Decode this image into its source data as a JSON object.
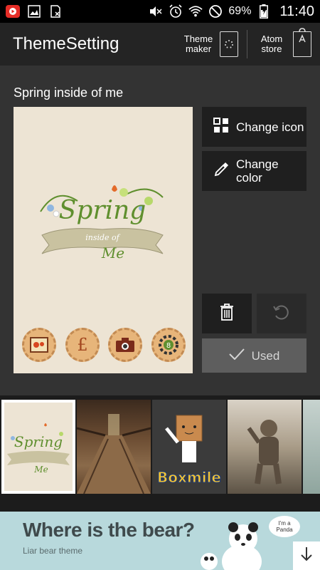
{
  "status_bar": {
    "battery_percent": "69%",
    "time": "11:40",
    "icons": [
      "youtube-icon",
      "gallery-icon",
      "sim-icon",
      "mute-icon",
      "alarm-icon",
      "wifi-icon",
      "block-icon",
      "battery-charging-icon"
    ]
  },
  "app_bar": {
    "title": "ThemeSetting",
    "theme_maker_label": "Theme\nmaker",
    "atom_store_label": "Atom\nstore"
  },
  "theme": {
    "name": "Spring inside of me",
    "art_text_main": "Spring",
    "art_text_ribbon": "inside of",
    "art_text_me": "Me"
  },
  "actions": {
    "change_icon": "Change icon",
    "change_color": "Change\ncolor",
    "used": "Used"
  },
  "thumbnails": [
    {
      "name": "spring-inside-of-me",
      "selected": true,
      "text": "Spring"
    },
    {
      "name": "bridge",
      "selected": false
    },
    {
      "name": "boxmile",
      "selected": false,
      "text": "Boxmile"
    },
    {
      "name": "baby",
      "selected": false
    },
    {
      "name": "rain",
      "selected": false
    }
  ],
  "banner": {
    "title": "Where is the bear?",
    "subtitle": "Liar bear theme",
    "bubble": "I'm a\nPanda"
  },
  "colors": {
    "accent_green": "#5f8f2e",
    "preview_bg": "#ede4d4",
    "banner_bg": "#b8d9dc"
  }
}
